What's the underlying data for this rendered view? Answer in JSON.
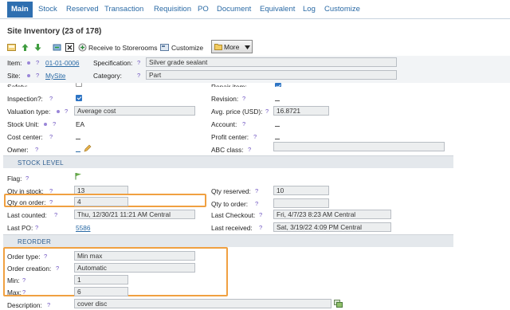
{
  "tabs": [
    {
      "label": "Main"
    },
    {
      "label": "Stock"
    },
    {
      "label": "Reserved"
    },
    {
      "label": "Transaction"
    },
    {
      "label": "Requisition"
    },
    {
      "label": "PO"
    },
    {
      "label": "Document"
    },
    {
      "label": "Equivalent"
    },
    {
      "label": "Log"
    },
    {
      "label": "Customize"
    }
  ],
  "page_title": "Site Inventory (23 of 178)",
  "toolbar": {
    "receive_label": "Receive to Storerooms",
    "customize_label": "Customize",
    "more_label": "More"
  },
  "header": {
    "item_label": "Item:",
    "item_value": "01-01-0006",
    "site_label": "Site:",
    "site_value": "MySite",
    "spec_label": "Specification:",
    "spec_value": "Silver grade sealant",
    "category_label": "Category:",
    "category_value": "Part"
  },
  "q": "?",
  "fields": {
    "safety_label": "Safety:",
    "repair_label": "Repair item:",
    "inspection_label": "Inspection?:",
    "revision_label": "Revision:",
    "valuation_label": "Valuation type:",
    "valuation_value": "Average cost",
    "avg_price_label": "Avg. price (USD):",
    "avg_price_value": "16.8721",
    "stock_unit_label": "Stock Unit:",
    "stock_unit_value": "EA",
    "account_label": "Account:",
    "cost_center_label": "Cost center:",
    "profit_center_label": "Profit center:",
    "owner_label": "Owner:",
    "abc_label": "ABC class:"
  },
  "stock_level": {
    "section_title": "STOCK LEVEL",
    "flag_label": "Flag:",
    "qty_in_stock_label": "Qty in stock:",
    "qty_in_stock_value": "13",
    "qty_reserved_label": "Qty reserved:",
    "qty_reserved_value": "10",
    "qty_on_order_label": "Qty on order:",
    "qty_on_order_value": "4",
    "qty_to_order_label": "Qty to order:",
    "qty_to_order_value": "",
    "last_counted_label": "Last counted:",
    "last_counted_value": "Thu, 12/30/21 11:21 AM Central",
    "last_checkout_label": "Last Checkout:",
    "last_checkout_value": "Fri, 4/7/23 8:23 AM Central",
    "last_po_label": "Last PO:",
    "last_po_value": "5586",
    "last_received_label": "Last received:",
    "last_received_value": "Sat, 3/19/22 4:09 PM Central"
  },
  "reorder": {
    "section_title": "REORDER",
    "order_type_label": "Order type:",
    "order_type_value": "Min max",
    "order_creation_label": "Order creation:",
    "order_creation_value": "Automatic",
    "min_label": "Min:",
    "min_value": "1",
    "max_label": "Max:",
    "max_value": "6",
    "description_label": "Description:",
    "description_value": "cover disc"
  },
  "colors": {
    "accent": "#2f6fb0",
    "highlight": "#f0a041",
    "link": "#2a6aa5"
  }
}
